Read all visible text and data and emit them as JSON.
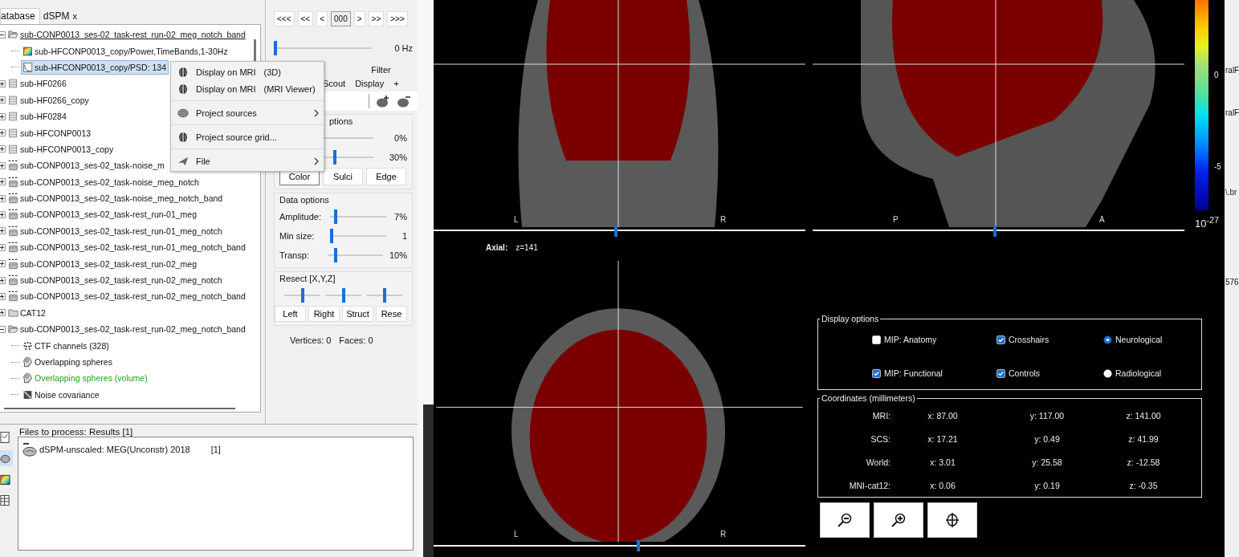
{
  "database_panel": {
    "tabs": [
      {
        "label": "atabase",
        "selected": true
      },
      {
        "label": "dSPM",
        "selected": false,
        "close": "x"
      }
    ],
    "tree": [
      {
        "kind": "folder-open",
        "label": "sub-CONP0013_ses-02_task-rest_run-02_meg_notch_band",
        "selected": false,
        "current": true,
        "expanded": true,
        "children": [
          {
            "kind": "timefreq",
            "label": "sub-HFCONP0013_copy/Power,TimeBands,1-30Hz",
            "selected": false
          },
          {
            "kind": "psd",
            "label": "sub-HFCONP0013_copy/PSD: 134",
            "selected": true
          }
        ]
      },
      {
        "kind": "subject",
        "label": "sub-HF0266",
        "selected": false,
        "current": false,
        "expanded": false
      },
      {
        "kind": "subject",
        "label": "sub-HF0266_copy",
        "selected": false,
        "current": false,
        "expanded": false
      },
      {
        "kind": "subject",
        "label": "sub-HF0284",
        "selected": false,
        "current": false,
        "expanded": false
      },
      {
        "kind": "subject",
        "label": "sub-HFCONP0013",
        "selected": false,
        "current": false,
        "expanded": false
      },
      {
        "kind": "subject",
        "label": "sub-HFCONP0013_copy",
        "selected": false,
        "current": false,
        "expanded": false
      },
      {
        "kind": "raw",
        "label": "sub-CONP0013_ses-02_task-noise_m",
        "selected": false,
        "current": false,
        "expanded": false
      },
      {
        "kind": "raw",
        "label": "sub-CONP0013_ses-02_task-noise_meg_notch",
        "selected": false,
        "current": false,
        "expanded": false
      },
      {
        "kind": "raw",
        "label": "sub-CONP0013_ses-02_task-noise_meg_notch_band",
        "selected": false,
        "current": false,
        "expanded": false
      },
      {
        "kind": "raw",
        "label": "sub-CONP0013_ses-02_task-rest_run-01_meg",
        "selected": false,
        "current": false,
        "expanded": false
      },
      {
        "kind": "raw",
        "label": "sub-CONP0013_ses-02_task-rest_run-01_meg_notch",
        "selected": false,
        "current": false,
        "expanded": false
      },
      {
        "kind": "raw",
        "label": "sub-CONP0013_ses-02_task-rest_run-01_meg_notch_band",
        "selected": false,
        "current": false,
        "expanded": false
      },
      {
        "kind": "raw",
        "label": "sub-CONP0013_ses-02_task-rest_run-02_meg",
        "selected": false,
        "current": false,
        "expanded": false
      },
      {
        "kind": "raw",
        "label": "sub-CONP0013_ses-02_task-rest_run-02_meg_notch",
        "selected": false,
        "current": false,
        "expanded": false
      },
      {
        "kind": "raw",
        "label": "sub-CONP0013_ses-02_task-rest_run-02_meg_notch_band",
        "selected": false,
        "current": false,
        "expanded": false
      },
      {
        "kind": "folder",
        "label": "CAT12",
        "selected": false,
        "current": false,
        "expanded": false
      },
      {
        "kind": "folder-open",
        "label": "sub-CONP0013_ses-02_task-rest_run-02_meg_notch_band",
        "selected": false,
        "current": false,
        "expanded": true,
        "children": [
          {
            "kind": "channels",
            "label": "CTF channels (328)",
            "selected": false,
            "default": false
          },
          {
            "kind": "headmodel",
            "label": "Overlapping spheres",
            "selected": false,
            "default": false
          },
          {
            "kind": "headmodel",
            "label": "Overlapping spheres (volume)",
            "selected": false,
            "default": true
          },
          {
            "kind": "noisecov",
            "label": "Noise covariance",
            "selected": false,
            "default": false
          }
        ]
      }
    ]
  },
  "context_menu": {
    "items": [
      {
        "kind": "mri",
        "label": "Display on MRI",
        "hint": "(3D)",
        "submenu": false,
        "separator_before": false
      },
      {
        "kind": "mri",
        "label": "Display on MRI",
        "hint": "(MRI Viewer)",
        "submenu": false,
        "separator_before": false
      },
      {
        "kind": "sources",
        "label": "Project sources",
        "submenu": true,
        "separator_before": true
      },
      {
        "kind": "mri",
        "label": "Project source grid...",
        "submenu": false,
        "separator_before": true
      },
      {
        "kind": "file",
        "label": "File",
        "submenu": true,
        "separator_before": true
      }
    ]
  },
  "time_panel": {
    "nav": [
      {
        "kind": "button",
        "label": "<<<"
      },
      {
        "kind": "button",
        "label": "<<"
      },
      {
        "kind": "button",
        "label": "<"
      },
      {
        "kind": "field",
        "label": "000"
      },
      {
        "kind": "button",
        "label": ">"
      },
      {
        "kind": "button",
        "label": ">>"
      },
      {
        "kind": "button",
        "label": ">>>"
      }
    ],
    "frequency": {
      "level": 0,
      "reading": "0 Hz"
    }
  },
  "tabs_row_1": [
    {
      "label": "Filter",
      "selected": false
    }
  ],
  "tabs_row_2": [
    {
      "label": "Scout",
      "selected": false
    },
    {
      "label": "Display",
      "selected": false
    },
    {
      "label": "+",
      "selected": false
    }
  ],
  "surface_options": {
    "title": "ptions",
    "sliders": [
      {
        "level": 0,
        "reading": "0%"
      },
      {
        "level": 0.3,
        "reading": "30%"
      }
    ],
    "buttons": [
      {
        "label": "Color",
        "selected": true
      },
      {
        "label": "Sulci",
        "selected": false
      },
      {
        "label": "Edge",
        "selected": false
      }
    ]
  },
  "data_options": {
    "title": "Data options",
    "sliders": [
      {
        "label": "Amplitude:",
        "level": 0.07,
        "reading": "7%"
      },
      {
        "label": "Min size:",
        "level": 0,
        "reading": "1"
      },
      {
        "label": "Transp:",
        "level": 0.1,
        "reading": "10%"
      }
    ]
  },
  "resect": {
    "title": "Resect [X,Y,Z]",
    "sliders": [
      {
        "level": 0.5
      },
      {
        "level": 0.5
      },
      {
        "level": 0.5
      }
    ],
    "buttons": [
      "Left",
      "Right",
      "Struct",
      "Rese"
    ]
  },
  "surface_info": [
    "Vertices: 0",
    "Faces: 0"
  ],
  "files_to_process": {
    "title": "Files to process: Results [1]",
    "tools": [
      {
        "kind": "recordings",
        "selected": false
      },
      {
        "kind": "sources",
        "selected": true
      },
      {
        "kind": "timefreq",
        "selected": false
      },
      {
        "kind": "matrix",
        "selected": false
      }
    ],
    "items": [
      {
        "label": "dSPM-unscaled: MEG(Unconstr) 2018",
        "count": "[1]"
      }
    ]
  },
  "mri_viewer": {
    "views": [
      {
        "kind": "coronal",
        "left": "L",
        "right": "R",
        "level": 0.49
      },
      {
        "kind": "sagittal",
        "left": "P",
        "right": "A",
        "level": 0.49
      }
    ],
    "colorbar": {
      "ticks": [
        "0",
        "-5"
      ],
      "exponent": "10$^{-27}$"
    },
    "axial": {
      "label": "Axial:",
      "value": "z=141",
      "left": "L",
      "right": "R",
      "level": 0.55
    },
    "display_options": {
      "title": "Display options",
      "options": [
        {
          "kind": "checkbox",
          "label": "MIP: Anatomy",
          "checked": false
        },
        {
          "kind": "checkbox",
          "label": "Crosshairs",
          "checked": true
        },
        {
          "kind": "radio",
          "label": "Neurological",
          "selected": true
        },
        {
          "kind": "checkbox",
          "label": "MIP: Functional",
          "checked": true
        },
        {
          "kind": "checkbox",
          "label": "Controls",
          "checked": true
        },
        {
          "kind": "radio",
          "label": "Radiological",
          "selected": false
        }
      ]
    },
    "coordinates": {
      "title": "Coordinates (millimeters)",
      "rows": [
        {
          "label": "MRI:",
          "x": "x: 87.00",
          "y": "y: 117.00",
          "z": "z: 141.00"
        },
        {
          "label": "SCS:",
          "x": "x: 17.21",
          "y": "y: 0.49",
          "z": "z: 41.99"
        },
        {
          "label": "World:",
          "x": "x: 3.01",
          "y": "y: 25.58",
          "z": "z: -12.58"
        },
        {
          "label": "MNI-cat12:",
          "x": "x: 0.06",
          "y": "y: 0.19",
          "z": "z: -0.35"
        }
      ]
    },
    "tools": [
      {
        "kind": "zoom-out"
      },
      {
        "kind": "zoom-in"
      },
      {
        "kind": "crosshair"
      }
    ]
  },
  "right_strip": [
    "ralF",
    "ralF",
    "\\.br",
    "576"
  ]
}
